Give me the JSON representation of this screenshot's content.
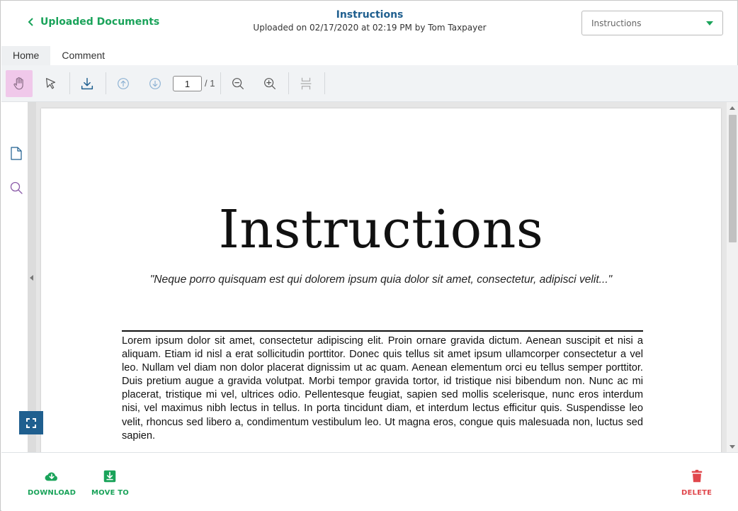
{
  "header": {
    "back_label": "Uploaded Documents",
    "title": "Instructions",
    "subtitle": "Uploaded on 02/17/2020 at 02:19 PM by Tom Taxpayer",
    "document_select": {
      "selected": "Instructions"
    }
  },
  "tabs": [
    {
      "label": "Home",
      "active": true
    },
    {
      "label": "Comment",
      "active": false
    }
  ],
  "toolbar": {
    "tools": [
      "pan-hand-icon",
      "select-arrow-icon",
      "download-icon",
      "previous-page-icon",
      "next-page-icon",
      "zoom-out-icon",
      "zoom-in-icon",
      "page-layout-icon"
    ],
    "current_page": "1",
    "total_pages": "/ 1"
  },
  "left_panel": {
    "icons": [
      "pages-icon",
      "search-icon",
      "fullscreen-icon"
    ]
  },
  "document": {
    "title": "Instructions",
    "quote": "\"Neque porro quisquam est qui dolorem ipsum quia dolor sit amet, consectetur, adipisci velit...\"",
    "body": "Lorem ipsum dolor sit amet, consectetur adipiscing elit. Proin ornare gravida dictum. Aenean suscipit et nisi a aliquam. Etiam id nisl a erat sollicitudin porttitor. Donec quis tellus sit amet ipsum ullamcorper consectetur a vel leo. Nullam vel diam non dolor placerat dignissim ut ac quam. Aenean elementum orci eu tellus semper porttitor. Duis pretium augue a gravida volutpat. Morbi tempor gravida tortor, id tristique nisi bibendum non. Nunc ac mi placerat, tristique mi vel, ultrices odio. Pellentesque feugiat, sapien sed mollis scelerisque, nunc eros interdum nisi, vel maximus nibh lectus in tellus. In porta tincidunt diam, et interdum lectus efficitur quis. Suspendisse leo velit, rhoncus sed libero a, condimentum vestibulum leo. Ut magna eros, congue quis malesuada non, luctus sed sapien."
  },
  "footer": {
    "download_label": "DOWNLOAD",
    "move_to_label": "MOVE TO",
    "delete_label": "DELETE"
  },
  "colors": {
    "accent_green": "#1aa35a",
    "title_blue": "#1f5f8f",
    "delete_red": "#e0474c",
    "active_tool": "#f0c8ea"
  }
}
